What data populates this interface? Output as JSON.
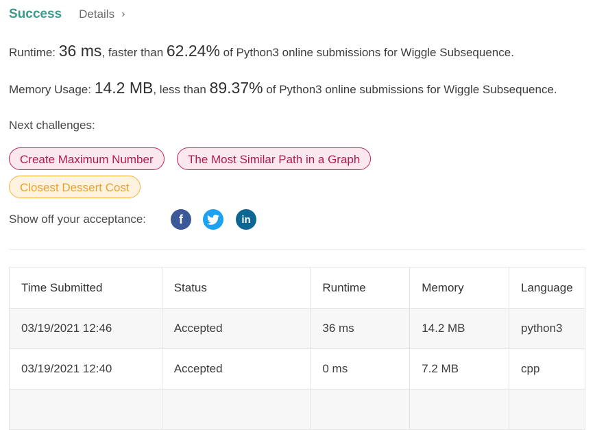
{
  "result": {
    "status": "Success",
    "details_label": "Details",
    "details_chevron": "›"
  },
  "runtime": {
    "prefix": "Runtime: ",
    "value": "36 ms",
    "middle": ", faster than ",
    "percent": "62.24%",
    "suffix": " of Python3 online submissions for Wiggle Subsequence."
  },
  "memory": {
    "prefix": "Memory Usage: ",
    "value": "14.2 MB",
    "middle": ", less than ",
    "percent": "89.37%",
    "suffix": " of Python3 online submissions for Wiggle Subsequence."
  },
  "challenges": {
    "label": "Next challenges:",
    "items": [
      {
        "title": "Create Maximum Number",
        "difficulty_color": "#c41f57"
      },
      {
        "title": "The Most Similar Path in a Graph",
        "difficulty_color": "#c41f57"
      },
      {
        "title": "Closest Dessert Cost",
        "difficulty_color": "#f5b142"
      }
    ]
  },
  "share": {
    "label": "Show off your acceptance:",
    "icons": [
      {
        "name": "facebook-icon",
        "glyph": "f",
        "color": "#3b5998"
      },
      {
        "name": "twitter-icon",
        "glyph": "🐦",
        "color": "#1da1f2"
      },
      {
        "name": "linkedin-icon",
        "glyph": "in",
        "color": "#0e6694"
      }
    ]
  },
  "table": {
    "headers": [
      "Time Submitted",
      "Status",
      "Runtime",
      "Memory",
      "Language"
    ],
    "rows": [
      [
        "03/19/2021 12:46",
        "Accepted",
        "36 ms",
        "14.2 MB",
        "python3"
      ],
      [
        "03/19/2021 12:40",
        "Accepted",
        "0 ms",
        "7.2 MB",
        "cpp"
      ]
    ]
  },
  "colors": {
    "accent": "#3d9a8b",
    "hard": "#c41f57",
    "medium": "#f5b142"
  }
}
